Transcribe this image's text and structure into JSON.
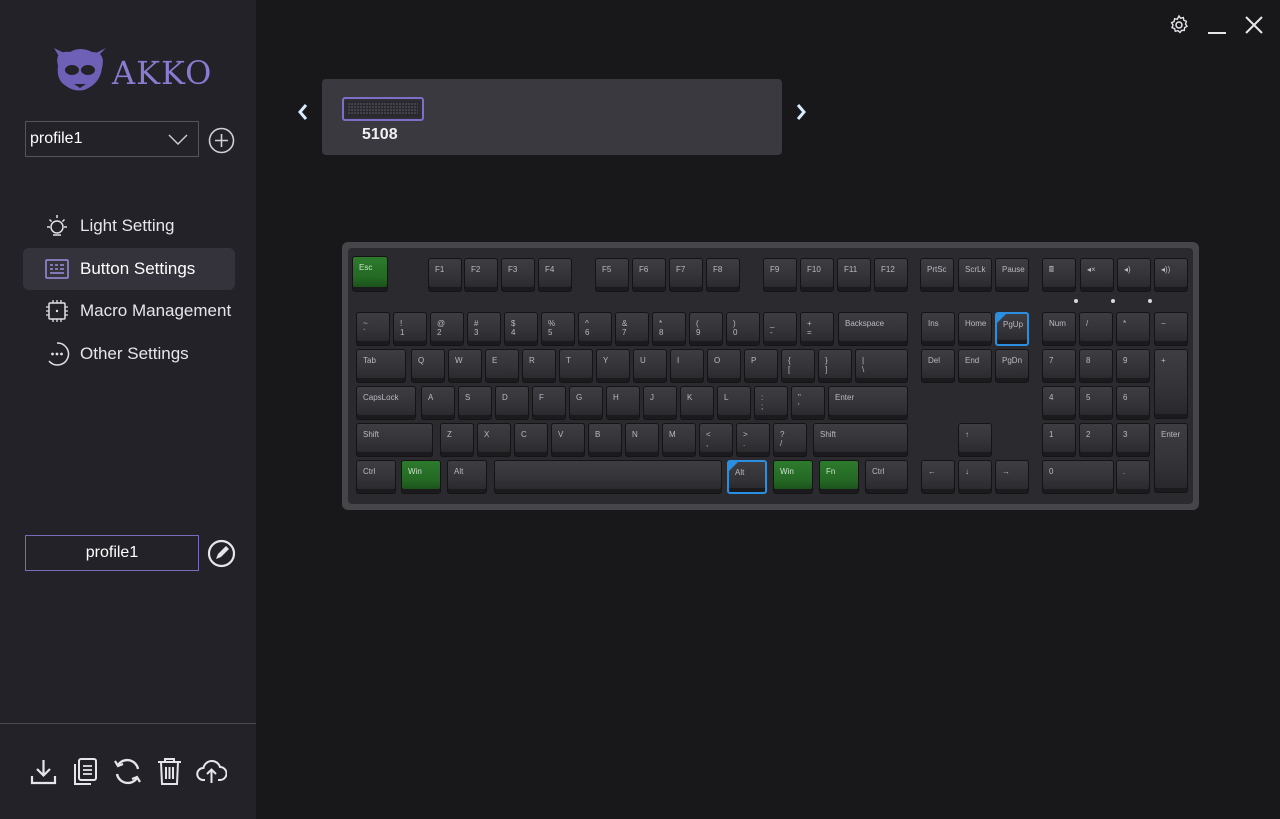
{
  "brand": {
    "name": "AKKO"
  },
  "sidebar": {
    "profile_select": {
      "value": "profile1"
    },
    "nav": [
      {
        "label": "Light Setting",
        "icon": "light-icon",
        "active": false
      },
      {
        "label": "Button Settings",
        "icon": "keyboard-icon",
        "active": true
      },
      {
        "label": "Macro Management",
        "icon": "chip-icon",
        "active": false
      },
      {
        "label": "Other Settings",
        "icon": "more-icon",
        "active": false
      }
    ],
    "profile_name": "profile1",
    "bottom_actions": [
      "import-icon",
      "copy-icon",
      "reset-icon",
      "delete-icon",
      "upload-icon"
    ]
  },
  "device": {
    "name": "5108"
  },
  "colors": {
    "accent": "#7e6fc6",
    "selected_key": "#2a8fe0",
    "green_key": "#2d7b2d"
  },
  "keyboard": {
    "keys": [
      [
        "Esc",
        "esc",
        "green"
      ],
      [
        "F1",
        "f1"
      ],
      [
        "F2",
        "f2"
      ],
      [
        "F3",
        "f3"
      ],
      [
        "F4",
        "f4"
      ],
      [
        "F5",
        "f5"
      ],
      [
        "F6",
        "f6"
      ],
      [
        "F7",
        "f7"
      ],
      [
        "F8",
        "f8"
      ],
      [
        "F9",
        "f9"
      ],
      [
        "F10",
        "f10"
      ],
      [
        "F11",
        "f11"
      ],
      [
        "F12",
        "f12"
      ],
      [
        "PrtSc",
        "prtsc"
      ],
      [
        "ScrLk",
        "scrlk"
      ],
      [
        "Pause",
        "pause"
      ],
      [
        "🖩",
        "calc"
      ],
      [
        "◂×",
        "mute"
      ],
      [
        "◂)",
        "vol-down"
      ],
      [
        "◂))",
        "vol-up"
      ],
      [
        "~\n`",
        "grave"
      ],
      [
        "!\n1",
        "1"
      ],
      [
        "@\n2",
        "2"
      ],
      [
        "#\n3",
        "3"
      ],
      [
        "$\n4",
        "4"
      ],
      [
        "%\n5",
        "5"
      ],
      [
        "^\n6",
        "6"
      ],
      [
        "&\n7",
        "7"
      ],
      [
        "*\n8",
        "8"
      ],
      [
        "(\n9",
        "9"
      ],
      [
        ")\n0",
        "0"
      ],
      [
        "_\n-",
        "minus"
      ],
      [
        "+\n=",
        "equal"
      ],
      [
        "Backspace",
        "backspace"
      ],
      [
        "Ins",
        "ins"
      ],
      [
        "Home",
        "home"
      ],
      [
        "PgUp",
        "pgup",
        "sel"
      ],
      [
        "Num",
        "numlock"
      ],
      [
        "/",
        "num-slash"
      ],
      [
        "*",
        "num-star"
      ],
      [
        "−",
        "num-minus"
      ],
      [
        "Tab",
        "tab"
      ],
      [
        "Q",
        "q"
      ],
      [
        "W",
        "w"
      ],
      [
        "E",
        "e"
      ],
      [
        "R",
        "r"
      ],
      [
        "T",
        "t"
      ],
      [
        "Y",
        "y"
      ],
      [
        "U",
        "u"
      ],
      [
        "I",
        "i"
      ],
      [
        "O",
        "o"
      ],
      [
        "P",
        "p"
      ],
      [
        "{\n[",
        "lbracket"
      ],
      [
        "}\n]",
        "rbracket"
      ],
      [
        "|\n\\",
        "backslash"
      ],
      [
        "Del",
        "del"
      ],
      [
        "End",
        "end"
      ],
      [
        "PgDn",
        "pgdn"
      ],
      [
        "7",
        "num7"
      ],
      [
        "8",
        "num8"
      ],
      [
        "9",
        "num9"
      ],
      [
        "+",
        "num-plus"
      ],
      [
        "CapsLock",
        "capslock"
      ],
      [
        "A",
        "a"
      ],
      [
        "S",
        "s"
      ],
      [
        "D",
        "d"
      ],
      [
        "F",
        "f"
      ],
      [
        "G",
        "g"
      ],
      [
        "H",
        "h"
      ],
      [
        "J",
        "j"
      ],
      [
        "K",
        "k"
      ],
      [
        "L",
        "l"
      ],
      [
        ":\n;",
        "semicolon"
      ],
      [
        "\"\n'",
        "quote"
      ],
      [
        "Enter",
        "enter"
      ],
      [
        "4",
        "num4"
      ],
      [
        "5",
        "num5"
      ],
      [
        "6",
        "num6"
      ],
      [
        "Shift",
        "lshift"
      ],
      [
        "Z",
        "z"
      ],
      [
        "X",
        "x"
      ],
      [
        "C",
        "c"
      ],
      [
        "V",
        "v"
      ],
      [
        "B",
        "b"
      ],
      [
        "N",
        "n"
      ],
      [
        "M",
        "m"
      ],
      [
        "<\n,",
        "comma"
      ],
      [
        ">\n.",
        "period"
      ],
      [
        "?\n/",
        "slash"
      ],
      [
        "Shift",
        "rshift"
      ],
      [
        "↑",
        "up"
      ],
      [
        "1",
        "num1"
      ],
      [
        "2",
        "num2"
      ],
      [
        "3",
        "num3"
      ],
      [
        "Enter",
        "num-enter"
      ],
      [
        "Ctrl",
        "lctrl"
      ],
      [
        "Win",
        "lwin",
        "green"
      ],
      [
        "Alt",
        "lalt"
      ],
      [
        "",
        "space"
      ],
      [
        "Alt",
        "ralt",
        "sel"
      ],
      [
        "Win",
        "rwin",
        "green"
      ],
      [
        "Fn",
        "fn",
        "green"
      ],
      [
        "Ctrl",
        "rctrl"
      ],
      [
        "←",
        "left"
      ],
      [
        "↓",
        "down"
      ],
      [
        "→",
        "right"
      ],
      [
        "0",
        "num0"
      ],
      [
        ".",
        "num-dot"
      ]
    ]
  }
}
